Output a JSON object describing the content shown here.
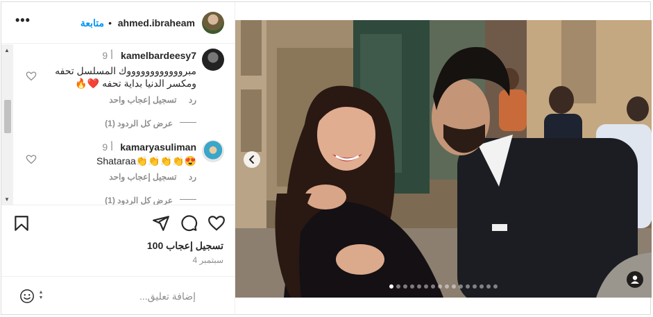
{
  "post": {
    "username": "ahmed.ibraheam",
    "separator": "•",
    "follow_label": "متابعة",
    "more_label": "•••"
  },
  "comments": [
    {
      "username": "kamelbardeesy7",
      "time": "9 أ",
      "text_line1": "مبرووووووووووووك المسلسل تحفه",
      "text_line2": "ومكسر الدنيا بداية تحفه ❤️🔥",
      "like_count_label": "تسجيل إعجاب واحد",
      "reply_label": "رد",
      "view_replies": "عرض كل الردود (1)"
    },
    {
      "username": "kamaryasuliman",
      "time": "9 أ",
      "text_line1": "Shataraa👏👏👏👏😍",
      "like_count_label": "تسجيل إعجاب واحد",
      "reply_label": "رد",
      "view_replies": "عرض كل الردود (1)"
    }
  ],
  "stats": {
    "likes": "100 تسجيل إعجاب",
    "date": "4 سبتمبر"
  },
  "composer": {
    "placeholder": "إضافة تعليق..."
  },
  "carousel": {
    "total": 16,
    "active_index": 0
  },
  "icons": {
    "heart": "heart-icon",
    "comment": "comment-icon",
    "share": "share-icon",
    "save": "bookmark-icon",
    "emoji": "emoji-icon",
    "tag": "user-tag-icon",
    "prev": "chevron-left-icon"
  },
  "colors": {
    "link": "#0095f6",
    "muted": "#8e8e8e",
    "text": "#262626",
    "border": "#dbdbdb"
  }
}
